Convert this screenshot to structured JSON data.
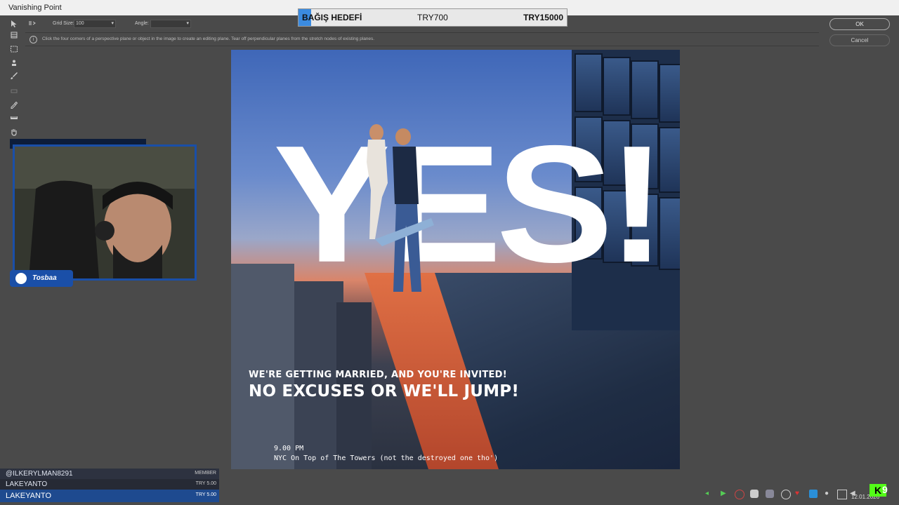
{
  "window": {
    "title": "Vanishing Point"
  },
  "options": {
    "grid_size_label": "Grid Size:",
    "grid_size_value": "100",
    "angle_label": "Angle:"
  },
  "info": {
    "text": "Click the four corners of a perspective plane or object in the image to create an editing plane. Tear off perpendicular planes from the stretch nodes of existing planes."
  },
  "buttons": {
    "ok": "OK",
    "cancel": "Cancel"
  },
  "donation": {
    "label": "BAĞIŞ HEDEFİ",
    "current": "TRY700",
    "goal": "TRY15000",
    "progress": 0.047
  },
  "poster": {
    "headline": "YES!",
    "line1": "WE'RE GETTING MARRIED, AND YOU'RE INVITED!",
    "line2": "NO EXCUSES OR WE'LL JUMP!",
    "time": "9.00 PM",
    "place": "NYC On Top of The Towers (not the destroyed one tho')"
  },
  "webcam": {
    "sponsor": "Tosbaa"
  },
  "chat": {
    "rows": [
      {
        "name": "@ILKERYLMAN8291",
        "tag": "MEMBER"
      },
      {
        "name": "LAKEYANTO",
        "tag": "TRY 5.00"
      },
      {
        "name": "LAKEYANTO",
        "tag": "TRY 5.00"
      }
    ]
  },
  "taskbar": {
    "date": "12.01.2026"
  },
  "colors": {
    "accent": "#3b8be0",
    "webcam_border": "#1a4fa8",
    "kick_green": "#53fc18"
  },
  "icons": [
    "arrow-pointer-icon",
    "create-plane-icon",
    "marquee-icon",
    "stamp-icon",
    "brush-icon",
    "transform-icon",
    "eyedropper-icon",
    "ruler-icon",
    "hand-icon",
    "info-icon"
  ]
}
